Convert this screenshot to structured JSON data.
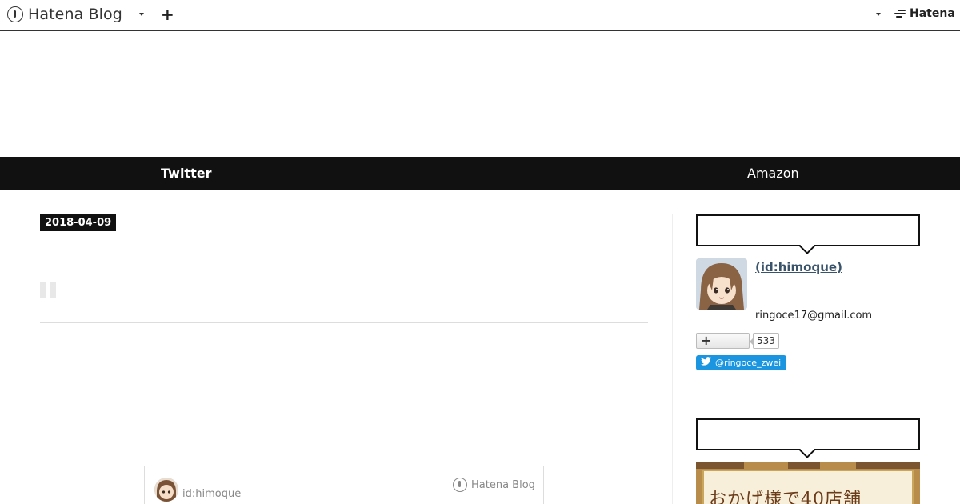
{
  "header": {
    "logo_text": "Hatena Blog",
    "plus_label": "+",
    "brand_text": "Hatena"
  },
  "nav": {
    "items": [
      {
        "label": "Twitter"
      },
      {
        "label": "Amazon"
      }
    ]
  },
  "entry": {
    "date": "2018-04-09"
  },
  "embed": {
    "user_id": "id:himoque",
    "logo_text": "Hatena Blog"
  },
  "sidebar": {
    "profile": {
      "name": " (id:himoque)",
      "email": "ringoce17@gmail.com",
      "follow_plus": "+",
      "follow_count": "533",
      "twitter_handle": "@ringoce_zwei"
    },
    "ad": {
      "text": "おかげ様で40店舗"
    }
  },
  "colors": {
    "nav_bg": "#111111",
    "link": "#39536b",
    "twitter_blue": "#1b95e0"
  }
}
